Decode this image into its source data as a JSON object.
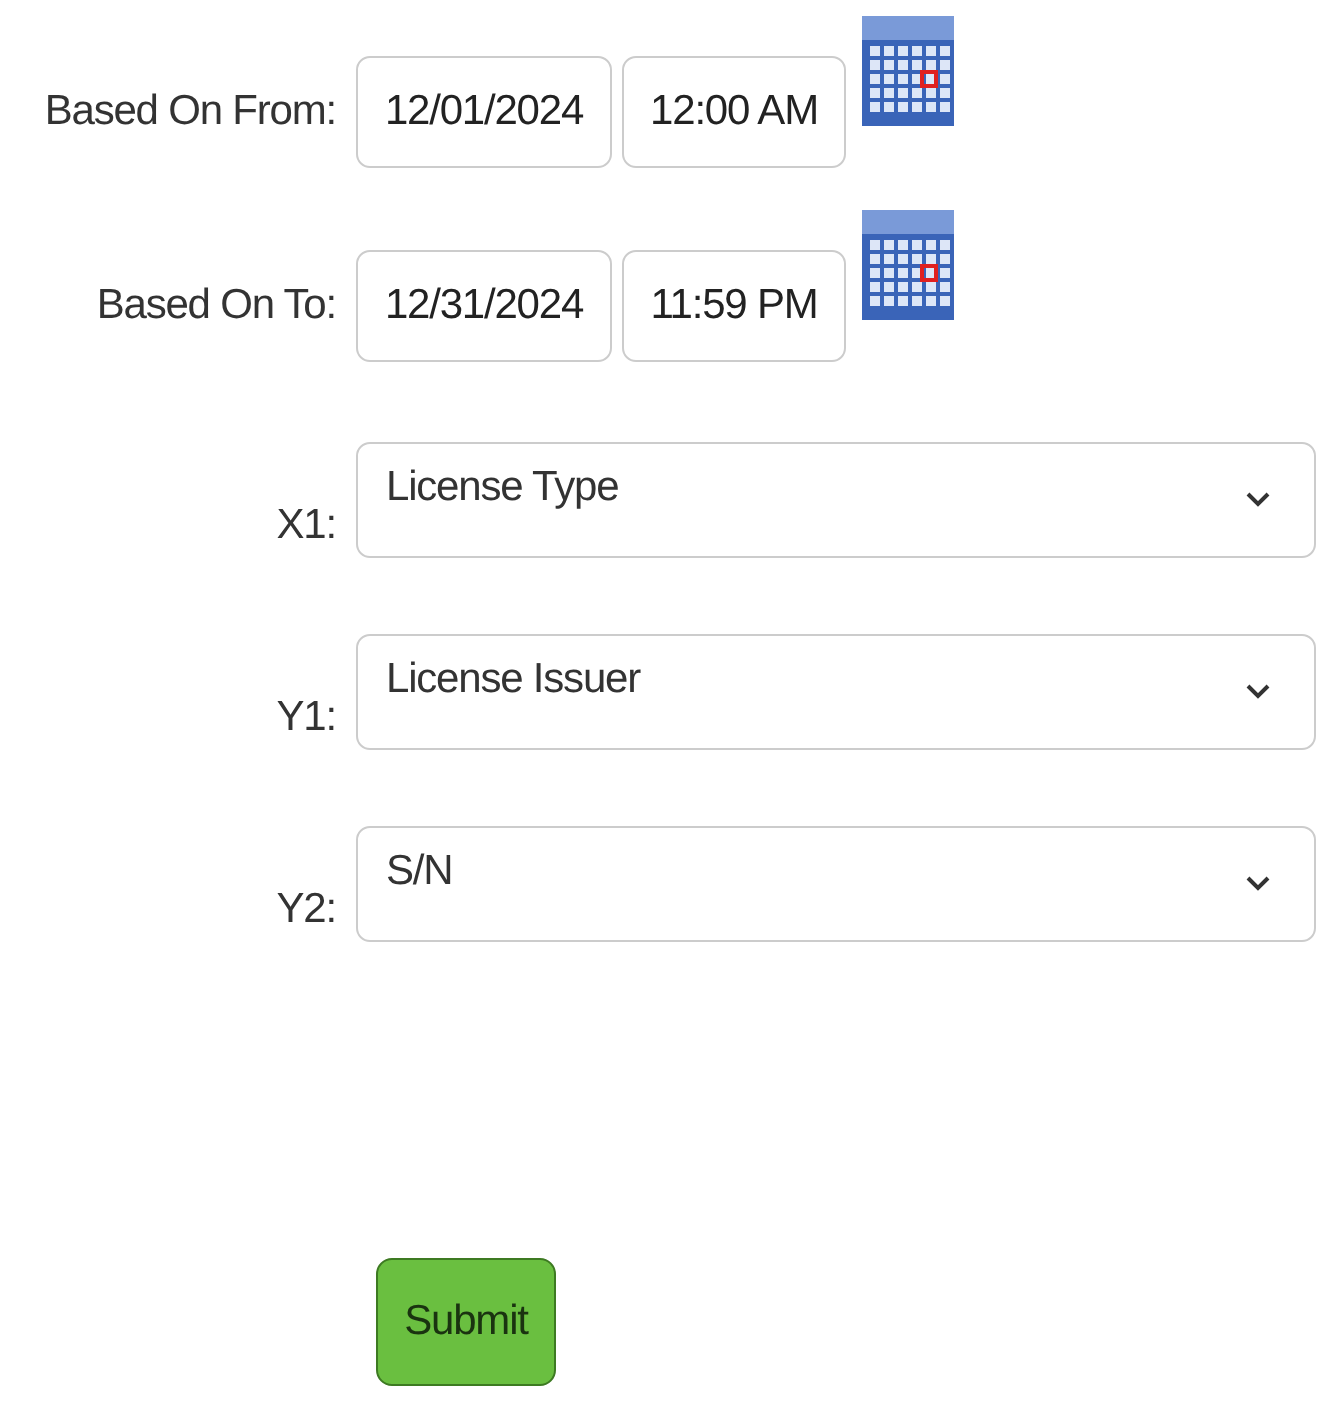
{
  "date_ranges": [
    {
      "label": "Based On From:",
      "date": "12/01/2024",
      "time": "12:00 AM"
    },
    {
      "label": "Based On To:",
      "date": "12/31/2024",
      "time": "11:59 PM"
    }
  ],
  "selects": [
    {
      "label": "X1:",
      "value": "License Type"
    },
    {
      "label": "Y1:",
      "value": "License Issuer"
    },
    {
      "label": "Y2:",
      "value": "S/N"
    }
  ],
  "submit": "Submit"
}
